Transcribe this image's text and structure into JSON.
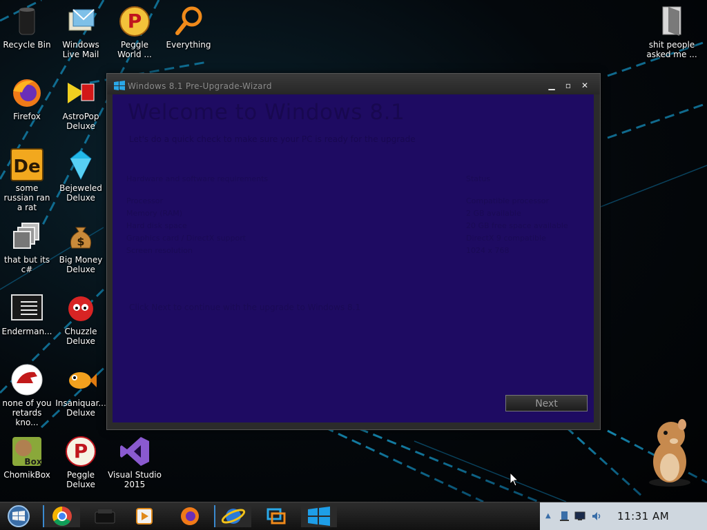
{
  "desktop": {
    "icons": [
      {
        "label": "Recycle Bin",
        "icon": "recycle-bin-icon"
      },
      {
        "label": "Windows Live Mail",
        "icon": "mail-icon"
      },
      {
        "label": "Peggle World ...",
        "icon": "peggle-icon"
      },
      {
        "label": "Everything",
        "icon": "search-icon"
      },
      {
        "label": "shit people asked me ...",
        "icon": "folder-icon"
      },
      {
        "label": "Firefox",
        "icon": "firefox-icon"
      },
      {
        "label": "AstroPop Deluxe",
        "icon": "astropop-icon"
      },
      {
        "label": "some russian ran a rat",
        "icon": "de-icon"
      },
      {
        "label": "Bejeweled Deluxe",
        "icon": "gem-icon"
      },
      {
        "label": "that but its c#",
        "icon": "copy-icon"
      },
      {
        "label": "Big Money Deluxe",
        "icon": "money-bag-icon"
      },
      {
        "label": "Enderman...",
        "icon": "console-icon"
      },
      {
        "label": "Chuzzle Deluxe",
        "icon": "chuzzle-icon"
      },
      {
        "label": "none of you retards kno...",
        "icon": "dino-icon"
      },
      {
        "label": "Insaniquar... Deluxe",
        "icon": "fish-icon"
      },
      {
        "label": "ChomikBox",
        "icon": "hamster-box-icon"
      },
      {
        "label": "Peggle Deluxe",
        "icon": "peggle-icon"
      },
      {
        "label": "Visual Studio 2015",
        "icon": "visual-studio-icon"
      }
    ]
  },
  "wizard": {
    "title": "Windows 8.1 Pre-Upgrade-Wizard",
    "heading": "Welcome to Windows 8.1",
    "subtitle": "Let's do a quick check to make sure your PC is ready for the upgrade",
    "left_header": "Hardware and software requirements",
    "left_lines": [
      "Processor",
      "Memory (RAM)",
      "Hard disk space",
      "Graphics card / DirectX support",
      "Screen resolution"
    ],
    "right_header": "Status",
    "right_lines": [
      "Compatible processor",
      "2 GB available",
      "20 GB free space available",
      "DirectX 9 compatible",
      "1024 x 768"
    ],
    "footer_note": "Click Next to continue with the upgrade to Windows 8.1",
    "next_label": "Next"
  },
  "taskbar": {
    "apps": [
      "start-orb-icon",
      "chrome-icon",
      "printer-icon",
      "media-player-icon",
      "firefox-icon",
      "ie-icon",
      "remote-desktop-icon",
      "windows-logo-icon"
    ],
    "clock": "11:31 AM"
  },
  "colors": {
    "wizard_bg": "#1e0b62",
    "tray_bg": "#cfd7df"
  }
}
